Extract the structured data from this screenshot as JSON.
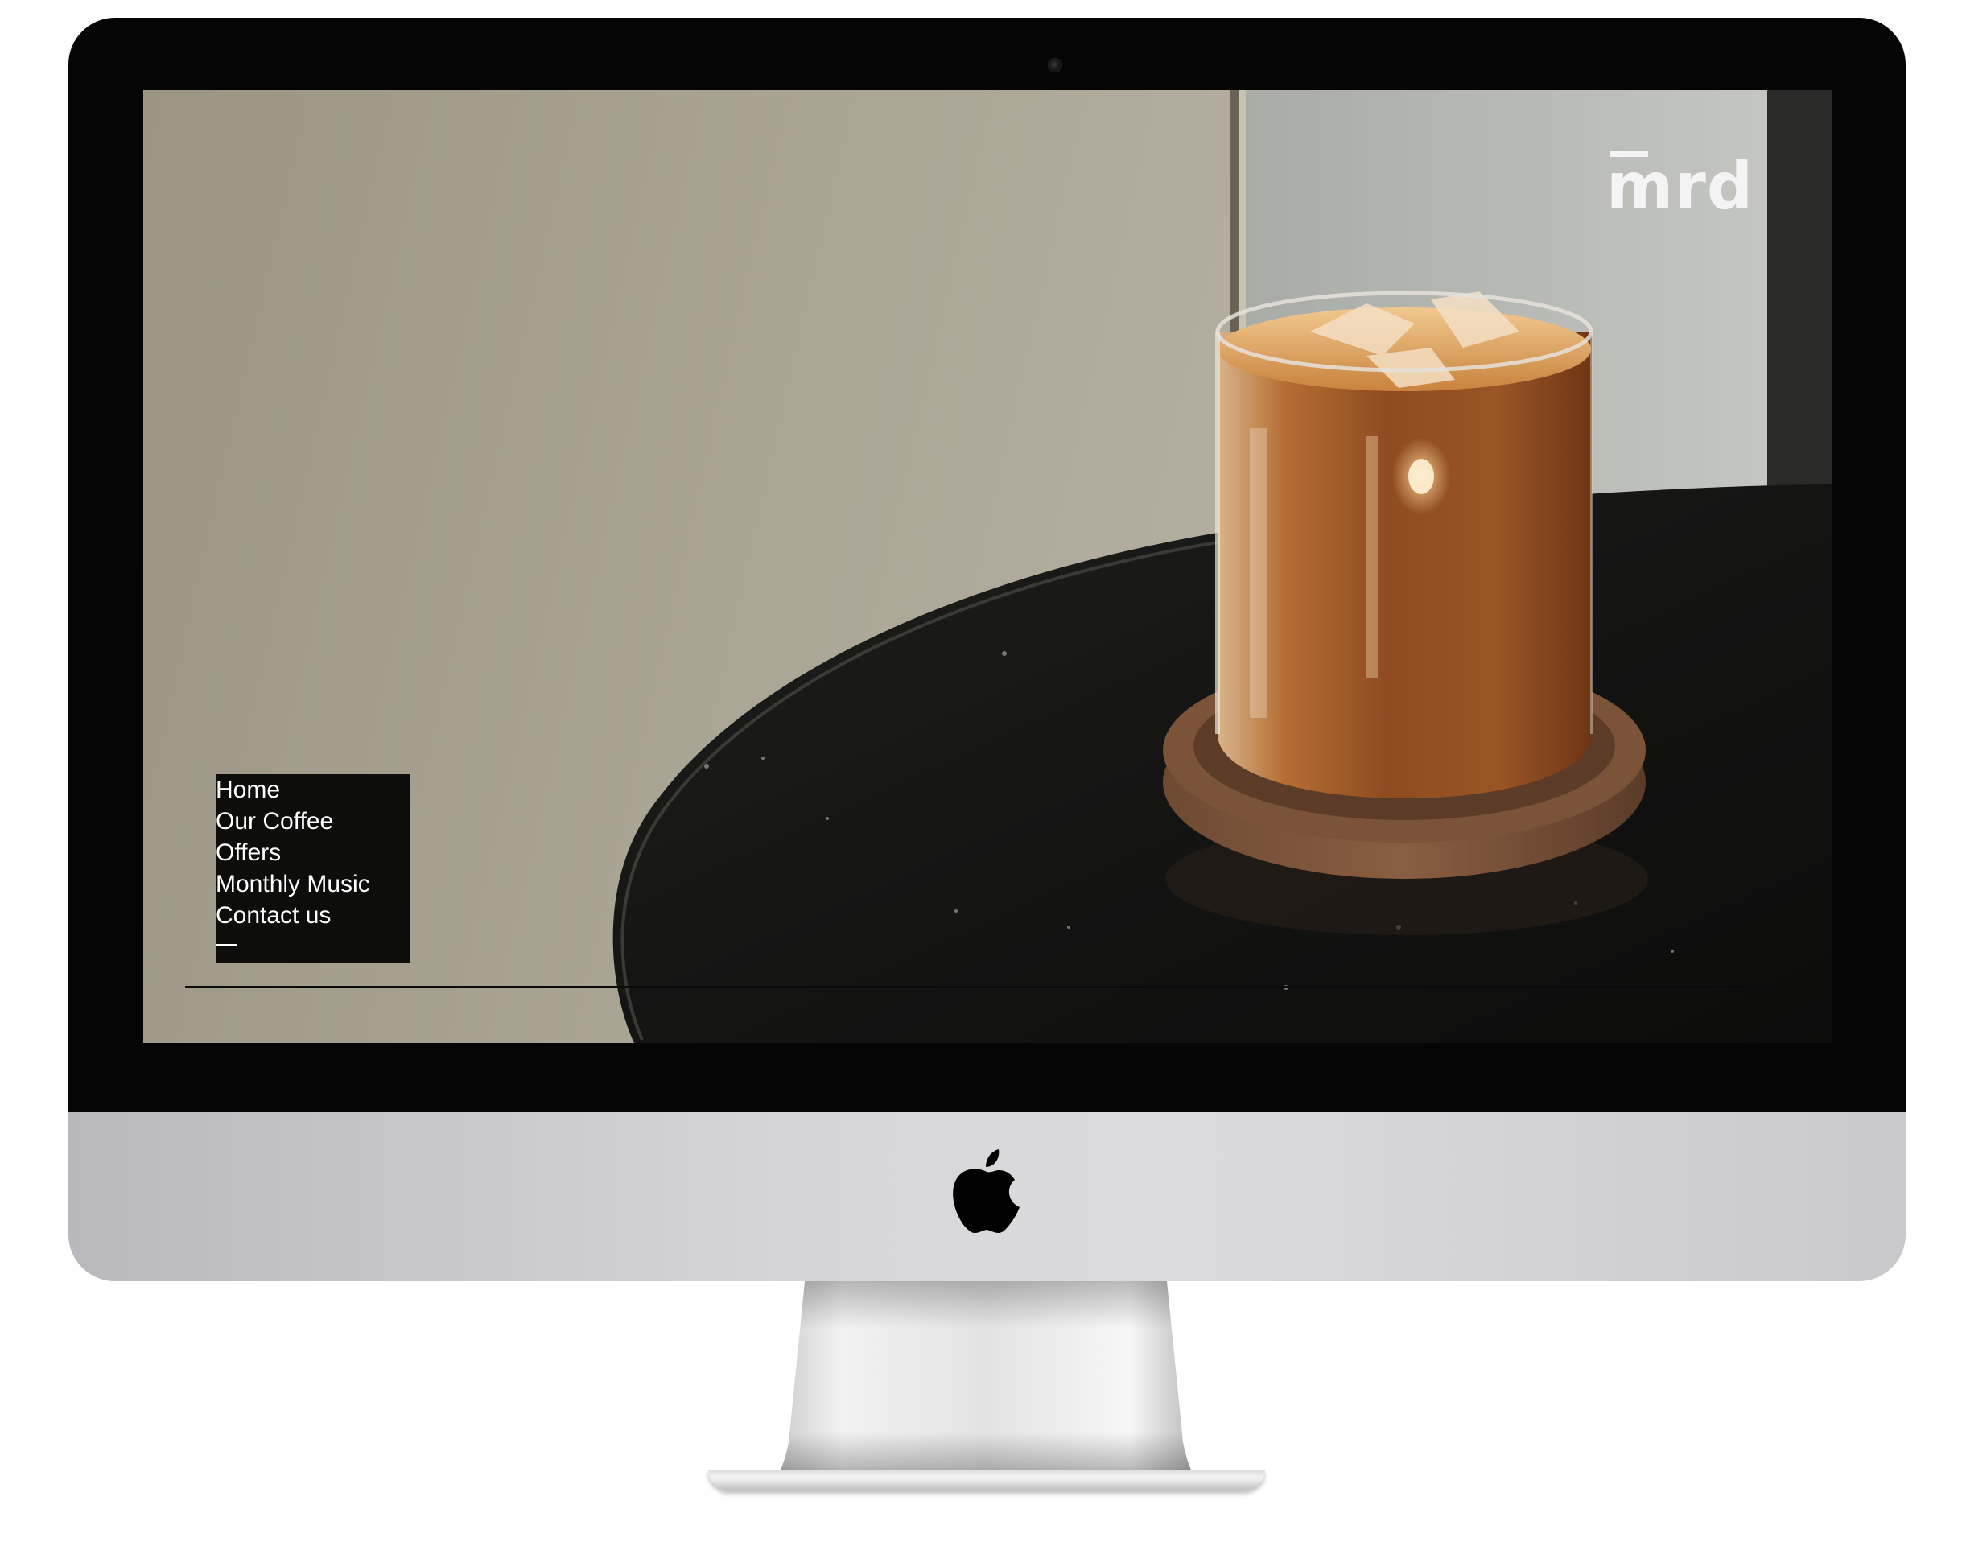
{
  "site": {
    "logo_text": "mrd"
  },
  "nav": {
    "items": [
      {
        "label": "Home"
      },
      {
        "label": "Our Coffee"
      },
      {
        "label": "Offers"
      },
      {
        "label": "Monthly Music"
      },
      {
        "label": "Contact us"
      }
    ]
  },
  "colors": {
    "bezel": "#050505",
    "chin": "#d6d6d9",
    "nav_background": "#0d0d0b",
    "nav_text": "#ffffff",
    "logo": "#f4f4f4"
  },
  "icons": {
    "device_logo": "apple-logo-icon",
    "camera": "camera-icon"
  }
}
